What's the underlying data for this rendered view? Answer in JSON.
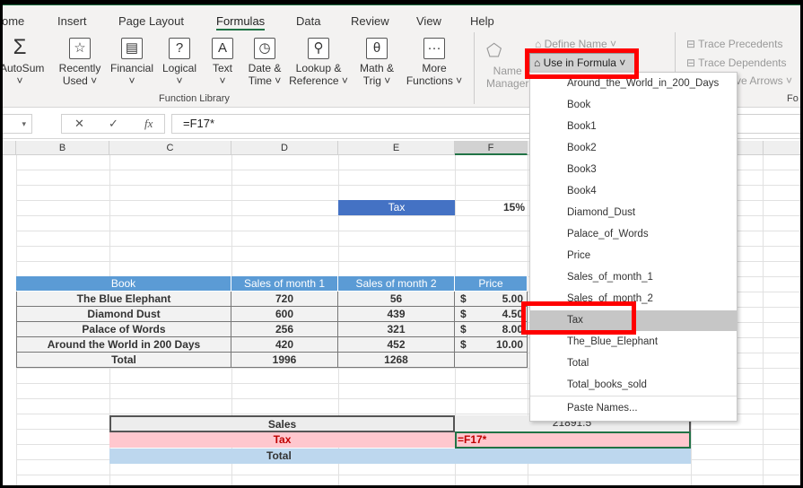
{
  "ribbon": {
    "tabs": [
      "ome",
      "Insert",
      "Page Layout",
      "Formulas",
      "Data",
      "Review",
      "View",
      "Help"
    ],
    "active_tab": "Formulas",
    "function_library": [
      {
        "l1": "AutoSum",
        "l2": "˅",
        "icon": "sigma-icon",
        "glyph": "Σ"
      },
      {
        "l1": "Recently",
        "l2": "Used ˅",
        "icon": "star-icon",
        "glyph": "☆"
      },
      {
        "l1": "Financial",
        "l2": "˅",
        "icon": "financial-icon",
        "glyph": "▤"
      },
      {
        "l1": "Logical",
        "l2": "˅",
        "icon": "question-icon",
        "glyph": "?"
      },
      {
        "l1": "Text",
        "l2": "˅",
        "icon": "text-icon",
        "glyph": "A"
      },
      {
        "l1": "Date &",
        "l2": "Time ˅",
        "icon": "clock-icon",
        "glyph": "◷"
      },
      {
        "l1": "Lookup &",
        "l2": "Reference ˅",
        "icon": "lookup-icon",
        "glyph": "⚲"
      },
      {
        "l1": "Math &",
        "l2": "Trig ˅",
        "icon": "theta-icon",
        "glyph": "θ"
      },
      {
        "l1": "More",
        "l2": "Functions ˅",
        "icon": "more-icon",
        "glyph": "···"
      }
    ],
    "function_library_label": "Function Library",
    "name_manager": [
      "Name",
      "Manager"
    ],
    "define_name": "Define Name ˅",
    "use_in_formula": "Use in Formula ˅",
    "trace_precedents": "Trace Precedents",
    "trace_dependents": "Trace Dependents",
    "remove_arrows": "ve Arrows ˅",
    "formula_group_partial": "Fo"
  },
  "formula_bar": {
    "value": "=F17*",
    "fx": "fx",
    "cancel": "✕",
    "enter": "✓"
  },
  "columns": [
    "B",
    "C",
    "D",
    "E",
    "F"
  ],
  "tax_label": "Tax",
  "tax_value": "15%",
  "table": {
    "headers": [
      "Book",
      "Sales of month 1",
      "Sales of month 2",
      "Price"
    ],
    "rows": [
      [
        "The Blue Elephant",
        "720",
        "56",
        "5.00"
      ],
      [
        "Diamond Dust",
        "600",
        "439",
        "4.50"
      ],
      [
        "Palace of Words",
        "256",
        "321",
        "8.00"
      ],
      [
        "Around the World in 200 Days",
        "420",
        "452",
        "10.00"
      ]
    ],
    "total": [
      "Total",
      "1996",
      "1268"
    ],
    "currency": "$"
  },
  "summary": {
    "sales_label": "Sales",
    "sales_value": "21891.5",
    "tax_label": "Tax",
    "tax_formula": "=F17*",
    "total_label": "Total"
  },
  "menu": {
    "items": [
      "Around_the_World_in_200_Days",
      "Book",
      "Book1",
      "Book2",
      "Book3",
      "Book4",
      "Diamond_Dust",
      "Palace_of_Words",
      "Price",
      "Sales_of_month_1",
      "Sales_of_month_2",
      "Tax",
      "The_Blue_Elephant",
      "Total",
      "Total_books_sold"
    ],
    "highlighted": "Tax",
    "paste_names": "Paste Names..."
  },
  "colors": {
    "excel_green": "#217346",
    "header_blue": "#5b9bd5",
    "tax_blue": "#4472c4",
    "pink": "#ffc7ce",
    "light_blue": "#bdd7ee",
    "highlight": "#ff0000"
  }
}
